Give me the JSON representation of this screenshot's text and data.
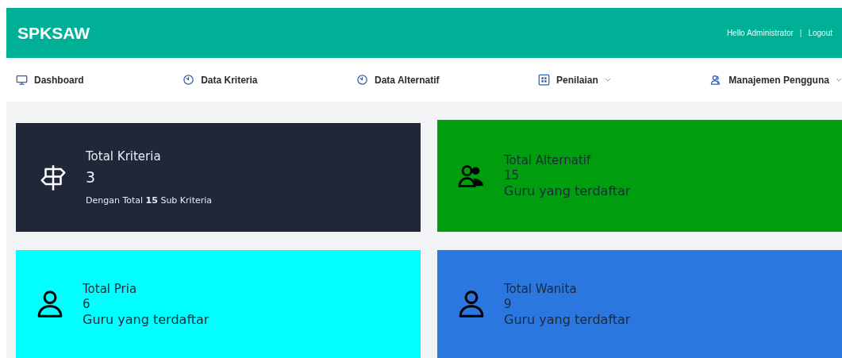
{
  "header": {
    "brand": "SPKSAW",
    "greeting": "Hello Administrator",
    "separator": "|",
    "logout": "Logout"
  },
  "nav": [
    {
      "label": "Dashboard",
      "dropdown": false
    },
    {
      "label": "Data Kriteria",
      "dropdown": false
    },
    {
      "label": "Data Alternatif",
      "dropdown": false
    },
    {
      "label": "Penilaian",
      "dropdown": true
    },
    {
      "label": "Manajemen Pengguna",
      "dropdown": true
    }
  ],
  "cards": [
    {
      "kind": "detail",
      "color": "#1f2738",
      "title": "Total Kriteria",
      "value": "3",
      "note": "Dengan Total **15** Sub Kriteria"
    },
    {
      "kind": "plain",
      "color": "#009e0f",
      "title": "Total Alternatif",
      "value": "15",
      "note": "Guru yang terdaftar"
    },
    {
      "kind": "plain",
      "color": "#00ffff",
      "title": "Total Pria",
      "value": "6",
      "note": "Guru yang terdaftar"
    },
    {
      "kind": "plain",
      "color": "#2b77e0",
      "title": "Total Wanita",
      "value": "9",
      "note": "Guru yang terdaftar"
    }
  ]
}
